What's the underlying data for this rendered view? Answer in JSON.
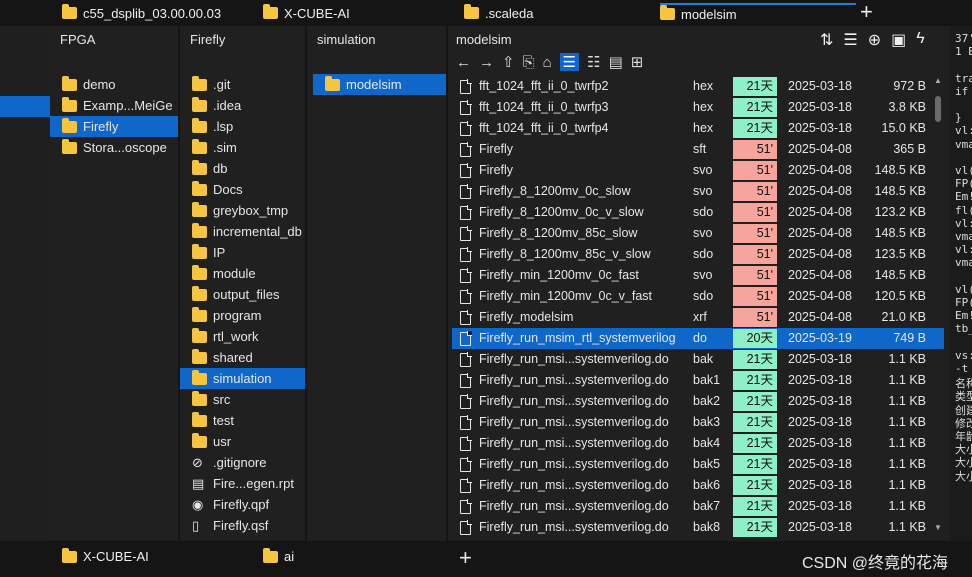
{
  "tabs": [
    "c55_dsplib_03.00.00.03",
    "X-CUBE-AI",
    ".scaleda",
    "modelsim"
  ],
  "columns": {
    "fpga": {
      "title": "FPGA",
      "items": [
        "demo",
        "Examp...MeiGe",
        "Firefly",
        "Stora...oscope"
      ]
    },
    "firefly": {
      "title": "Firefly",
      "items": [
        ".git",
        ".idea",
        ".lsp",
        ".sim",
        "db",
        "Docs",
        "greybox_tmp",
        "incremental_db",
        "IP",
        "module",
        "output_files",
        "program",
        "rtl_work",
        "shared",
        "simulation",
        "src",
        "test",
        "usr"
      ],
      "files": [
        ".gitignore",
        "Fire...egen.rpt",
        "Firefly.qpf",
        "Firefly.qsf"
      ]
    },
    "simulation": {
      "title": "simulation",
      "items": [
        "modelsim"
      ]
    }
  },
  "filelist": {
    "title": "modelsim",
    "rows": [
      {
        "name": "fft_1024_fft_ii_0_twrfp2",
        "ext": "hex",
        "age": "21天",
        "date": "2025-03-18",
        "size": "972 B"
      },
      {
        "name": "fft_1024_fft_ii_0_twrfp3",
        "ext": "hex",
        "age": "21天",
        "date": "2025-03-18",
        "size": "3.8 KB"
      },
      {
        "name": "fft_1024_fft_ii_0_twrfp4",
        "ext": "hex",
        "age": "21天",
        "date": "2025-03-18",
        "size": "15.0 KB"
      },
      {
        "name": "Firefly",
        "ext": "sft",
        "age": "51'",
        "date": "2025-04-08",
        "size": "365 B"
      },
      {
        "name": "Firefly",
        "ext": "svo",
        "age": "51'",
        "date": "2025-04-08",
        "size": "148.5 KB"
      },
      {
        "name": "Firefly_8_1200mv_0c_slow",
        "ext": "svo",
        "age": "51'",
        "date": "2025-04-08",
        "size": "148.5 KB"
      },
      {
        "name": "Firefly_8_1200mv_0c_v_slow",
        "ext": "sdo",
        "age": "51'",
        "date": "2025-04-08",
        "size": "123.2 KB"
      },
      {
        "name": "Firefly_8_1200mv_85c_slow",
        "ext": "svo",
        "age": "51'",
        "date": "2025-04-08",
        "size": "148.5 KB"
      },
      {
        "name": "Firefly_8_1200mv_85c_v_slow",
        "ext": "sdo",
        "age": "51'",
        "date": "2025-04-08",
        "size": "123.5 KB"
      },
      {
        "name": "Firefly_min_1200mv_0c_fast",
        "ext": "svo",
        "age": "51'",
        "date": "2025-04-08",
        "size": "148.5 KB"
      },
      {
        "name": "Firefly_min_1200mv_0c_v_fast",
        "ext": "sdo",
        "age": "51'",
        "date": "2025-04-08",
        "size": "120.5 KB"
      },
      {
        "name": "Firefly_modelsim",
        "ext": "xrf",
        "age": "51'",
        "date": "2025-04-08",
        "size": "21.0 KB"
      },
      {
        "name": "Firefly_run_msim_rtl_systemverilog",
        "ext": "do",
        "age": "20天",
        "date": "2025-03-19",
        "size": "749 B"
      },
      {
        "name": "Firefly_run_msi...systemverilog.do",
        "ext": "bak",
        "age": "21天",
        "date": "2025-03-18",
        "size": "1.1 KB"
      },
      {
        "name": "Firefly_run_msi...systemverilog.do",
        "ext": "bak1",
        "age": "21天",
        "date": "2025-03-18",
        "size": "1.1 KB"
      },
      {
        "name": "Firefly_run_msi...systemverilog.do",
        "ext": "bak2",
        "age": "21天",
        "date": "2025-03-18",
        "size": "1.1 KB"
      },
      {
        "name": "Firefly_run_msi...systemverilog.do",
        "ext": "bak3",
        "age": "21天",
        "date": "2025-03-18",
        "size": "1.1 KB"
      },
      {
        "name": "Firefly_run_msi...systemverilog.do",
        "ext": "bak4",
        "age": "21天",
        "date": "2025-03-18",
        "size": "1.1 KB"
      },
      {
        "name": "Firefly_run_msi...systemverilog.do",
        "ext": "bak5",
        "age": "21天",
        "date": "2025-03-18",
        "size": "1.1 KB"
      },
      {
        "name": "Firefly_run_msi...systemverilog.do",
        "ext": "bak6",
        "age": "21天",
        "date": "2025-03-18",
        "size": "1.1 KB"
      },
      {
        "name": "Firefly_run_msi...systemverilog.do",
        "ext": "bak7",
        "age": "21天",
        "date": "2025-03-18",
        "size": "1.1 KB"
      },
      {
        "name": "Firefly_run_msi...systemverilog.do",
        "ext": "bak8",
        "age": "21天",
        "date": "2025-03-18",
        "size": "1.1 KB"
      }
    ]
  },
  "preview": {
    "lines": [
      "37'",
      "1 B",
      "",
      "tra",
      "if",
      "",
      "}",
      "vl:",
      "vma",
      "",
      "vl(",
      "FP(",
      "Em!",
      "fl(",
      "vl:",
      "vma",
      "vl:",
      "vma",
      "",
      "vl(",
      "FP(",
      "Em!",
      "tb_",
      "",
      "vs:",
      "-t",
      "名称",
      "类型",
      "创建",
      "修改",
      "年龄",
      "大小",
      "大小",
      "大小"
    ]
  },
  "bottom_tabs": [
    "X-CUBE-AI",
    "ai"
  ],
  "watermark": "CSDN @终竟的花海",
  "colors": {
    "accent": "#0e67c9",
    "age_new": "#8ef0c6",
    "age_old": "#f7a59c",
    "folder": "#f5c542"
  }
}
